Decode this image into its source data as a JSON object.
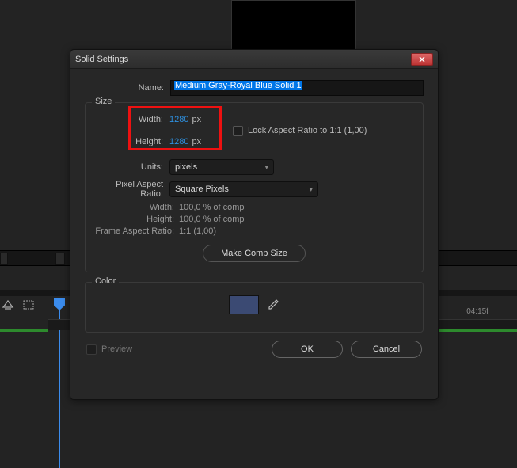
{
  "dialog": {
    "title": "Solid Settings",
    "name_label": "Name:",
    "name_value": "Medium Gray-Royal Blue Solid 1",
    "size": {
      "legend": "Size",
      "width_label": "Width:",
      "width_value": "1280",
      "width_unit": "px",
      "height_label": "Height:",
      "height_value": "1280",
      "height_unit": "px",
      "units_label": "Units:",
      "units_value": "pixels",
      "par_label": "Pixel Aspect Ratio:",
      "par_value": "Square Pixels",
      "lock_label": "Lock Aspect Ratio to 1:1 (1,00)",
      "info_width_label": "Width:",
      "info_width_value": "100,0 % of comp",
      "info_height_label": "Height:",
      "info_height_value": "100,0 % of comp",
      "info_far_label": "Frame Aspect Ratio:",
      "info_far_value": "1:1 (1,00)",
      "make_comp_label": "Make Comp Size"
    },
    "color": {
      "legend": "Color",
      "swatch_hex": "#3b4a73"
    },
    "preview_label": "Preview",
    "ok_label": "OK",
    "cancel_label": "Cancel"
  },
  "timeline": {
    "tick_label": "04:15f"
  }
}
